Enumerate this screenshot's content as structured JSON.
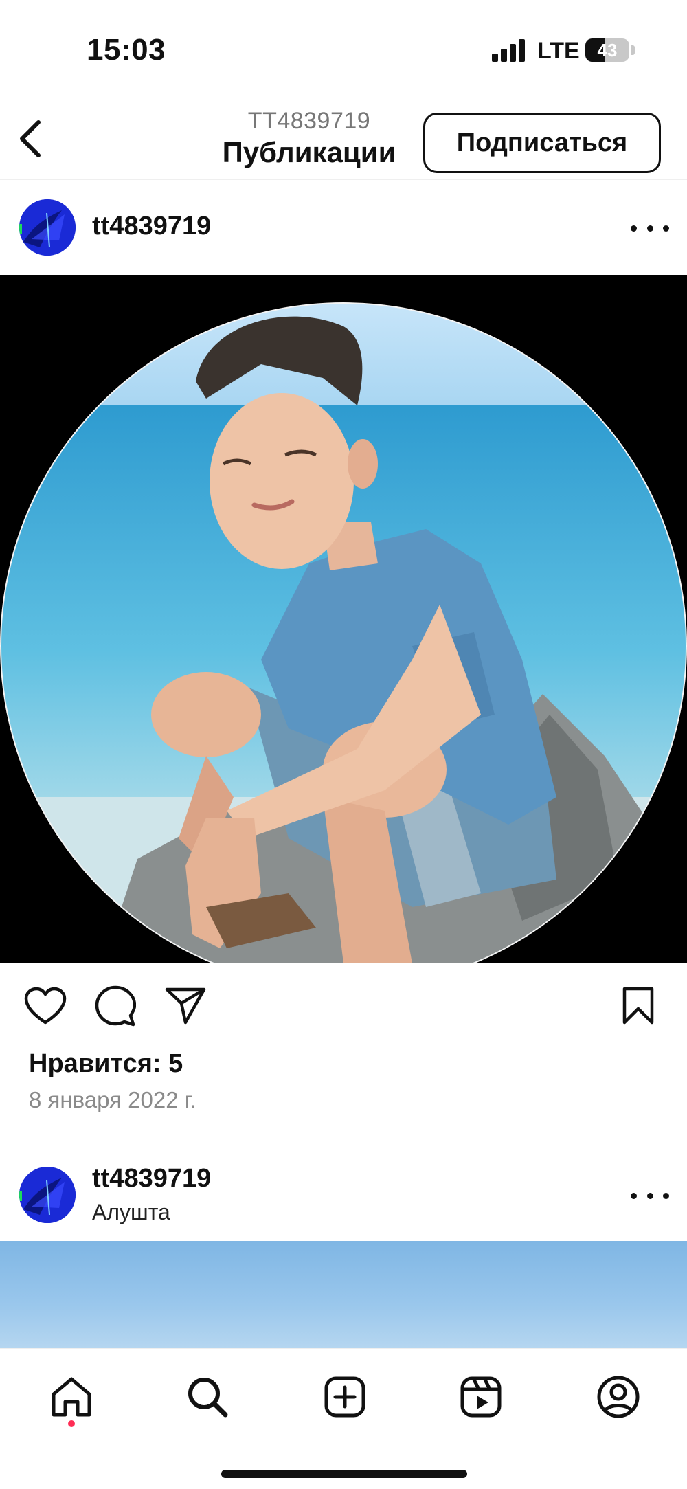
{
  "status_bar": {
    "time": "15:03",
    "network": "LTE",
    "battery_level": "43",
    "battery_fraction": 0.43
  },
  "header": {
    "account_id": "TT4839719",
    "title": "Публикации",
    "follow_label": "Подписаться"
  },
  "posts": [
    {
      "username": "tt4839719",
      "location": "",
      "likes_label": "Нравится: 5",
      "date": "8 января 2022 г."
    },
    {
      "username": "tt4839719",
      "location": "Алушта"
    }
  ],
  "icons": {
    "back": "chevron-left-icon",
    "more": "more-horizontal-icon",
    "like": "heart-icon",
    "comment": "comment-icon",
    "share": "send-icon",
    "save": "bookmark-icon",
    "nav": [
      "home-icon",
      "search-icon",
      "create-icon",
      "reels-icon",
      "profile-icon"
    ]
  },
  "colors": {
    "text": "#111111",
    "secondary": "#8a8a8a",
    "divider": "#efefef",
    "notification_dot": "#ff2d55"
  }
}
